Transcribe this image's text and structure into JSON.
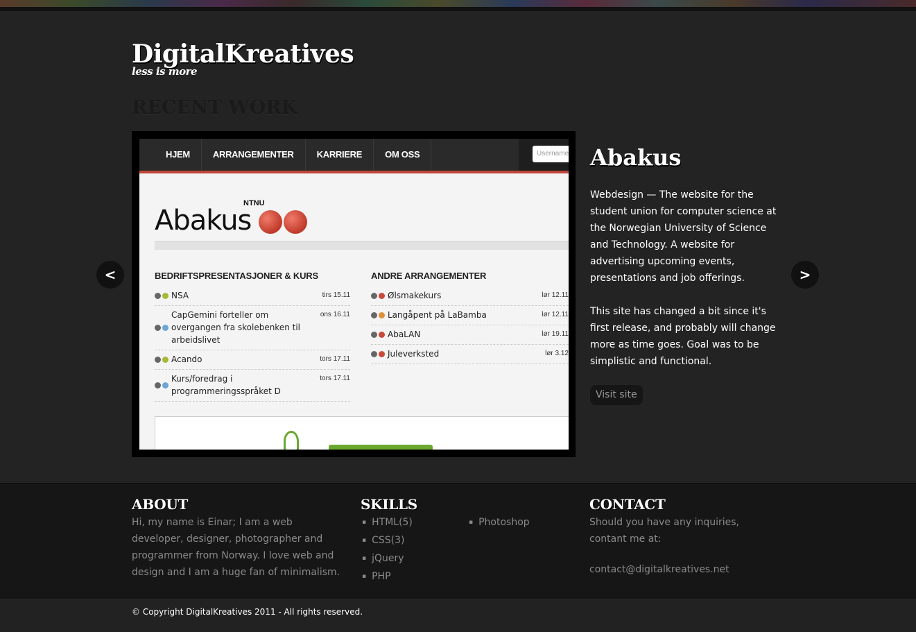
{
  "site": {
    "title": "DigitalKreatives",
    "tagline": "less is more"
  },
  "recent_work": {
    "heading": "RECENT WORK",
    "prev_arrow": "<",
    "next_arrow": ">"
  },
  "project": {
    "title": "Abakus",
    "description_1": "Webdesign — The website for the student union for computer science at the Norwegian University of Science and Technology. A website for advertising upcoming events, presentations and job offerings.",
    "description_2": "This site has changed a bit since it's first release, and probably will change more as time goes. Goal was to be simplistic and functional.",
    "visit_label": "Visit site"
  },
  "screenshot": {
    "nav": [
      "HJEM",
      "ARRANGEMENTER",
      "KARRIERE",
      "OM OSS"
    ],
    "username_placeholder": "Username",
    "brand": "Abakus",
    "brand_sub": "NTNU",
    "col1_heading": "BEDRIFTSPRESENTASJONER & KURS",
    "col2_heading": "ANDRE ARRANGEMENTER",
    "col1_rows": [
      {
        "title": "NSA",
        "date": "tirs 15.11"
      },
      {
        "title": "CapGemini forteller om overgangen fra skolebenken til arbeidslivet",
        "date": "ons 16.11"
      },
      {
        "title": "Acando",
        "date": "tors 17.11"
      },
      {
        "title": "Kurs/foredrag i programmeringsspråket D",
        "date": "tors 17.11"
      }
    ],
    "col2_rows": [
      {
        "title": "Ølsmakekurs",
        "date": "lør 12.11"
      },
      {
        "title": "Langåpent på LaBamba",
        "date": "lør 12.11"
      },
      {
        "title": "AbaLAN",
        "date": "lør 19.11"
      },
      {
        "title": "Juleverksted",
        "date": "lør 3.12"
      }
    ]
  },
  "footer": {
    "about_heading": "ABOUT",
    "about_text": "Hi, my name is Einar; I am a web developer, designer, photographer and programmer from Norway. I love web and design and I am a huge fan of minimalism.",
    "skills_heading": "SKILLS",
    "skills_col1": [
      "HTML(5)",
      "CSS(3)",
      "jQuery",
      "PHP"
    ],
    "skills_col2": [
      "Photoshop"
    ],
    "contact_heading": "CONTACT",
    "contact_text": "Should you have any inquiries, contant me at:",
    "contact_email": "contact@digitalkreatives.net"
  },
  "copyright": "© Copyright DigitalKreatives 2011 - All rights reserved."
}
